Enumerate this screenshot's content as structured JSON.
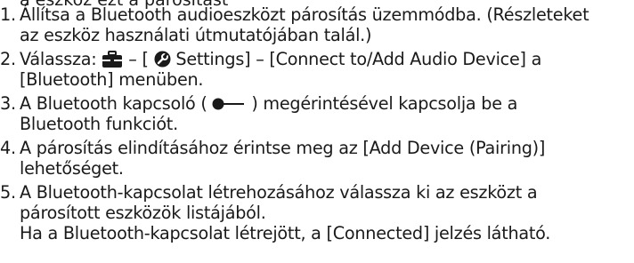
{
  "header_fragment": "a eszköz ezt a párosítást",
  "steps": [
    {
      "number": "1.",
      "lines": [
        "Állítsa a Bluetooth audioeszközt párosítás üzemmódba. (Részleteket",
        "az eszköz használati útmutatójában talál.)"
      ]
    },
    {
      "number": "2.",
      "line1_prefix": "Válassza:",
      "line1_dash": "– [",
      "line1_settings": "Settings] – [Connect to/Add Audio Device] a",
      "line2": "[Bluetooth] menüben.",
      "icons": [
        "toolbox-icon",
        "settings-gear-icon"
      ]
    },
    {
      "number": "3.",
      "line1_prefix": "A Bluetooth kapcsoló (",
      "line1_suffix": ") megérintésével kapcsolja be a",
      "line2": "Bluetooth funkciót.",
      "icons": [
        "toggle-switch-icon"
      ]
    },
    {
      "number": "4.",
      "lines": [
        "A párosítás elindításához érintse meg az [Add Device (Pairing)]",
        "lehetőséget."
      ]
    },
    {
      "number": "5.",
      "lines": [
        "A Bluetooth-kapcsolat létrehozásához válassza ki az eszközt a",
        "párosított eszközök listájából.",
        "Ha a Bluetooth-kapcsolat létrejött, a [Connected] jelzés látható."
      ]
    }
  ],
  "colors": {
    "text": "#1a1a1a",
    "icon": "#1a1a1a"
  }
}
